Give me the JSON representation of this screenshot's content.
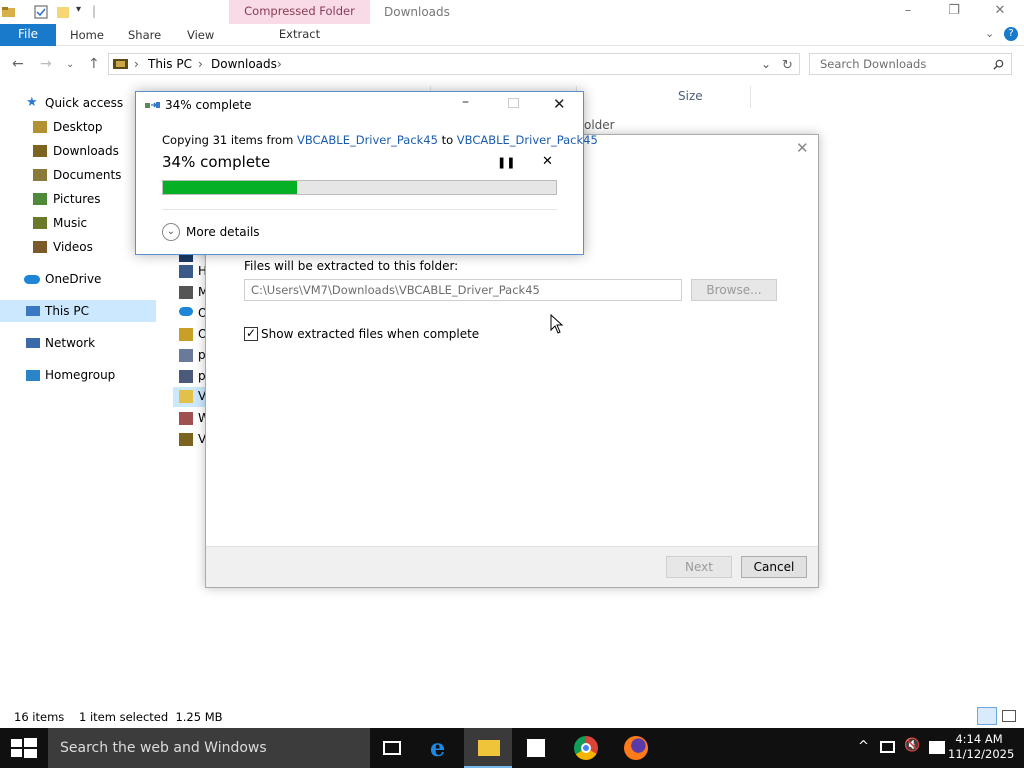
{
  "window": {
    "context_tab": "Compressed Folder Tools",
    "title": "Downloads",
    "tabs": [
      "File",
      "Home",
      "Share",
      "View"
    ],
    "extract_tab": "Extract"
  },
  "address": {
    "crumbs": [
      "This PC",
      "Downloads"
    ],
    "search_placeholder": "Search Downloads"
  },
  "navpane": {
    "items": [
      "Quick access",
      "Desktop",
      "Downloads",
      "Documents",
      "Pictures",
      "Music",
      "Videos",
      "OneDrive",
      "This PC",
      "Network",
      "Homegroup"
    ]
  },
  "filelist": {
    "size_header": "Size",
    "folder_fragment": "older",
    "row_letters": [
      "H",
      "M",
      "O",
      "O",
      "p",
      "p",
      "V",
      "W",
      "V"
    ]
  },
  "extract": {
    "folder_label": "Files will be extracted to this folder:",
    "path": "C:\\Users\\VM7\\Downloads\\VBCABLE_Driver_Pack45",
    "browse": "Browse...",
    "show_label": "Show extracted files when complete",
    "next": "Next",
    "cancel": "Cancel"
  },
  "progress": {
    "title": "34% complete",
    "copy_prefix": "Copying 31 items from",
    "source": "VBCABLE_Driver_Pack45",
    "to_word": "to",
    "dest": "VBCABLE_Driver_Pack45",
    "status": "34% complete",
    "value": 0.34,
    "more_details": "More details"
  },
  "statusbar": {
    "items": "16 items",
    "selected": "1 item selected  1.25 MB"
  },
  "taskbar": {
    "search_text": "Search the web and Windows",
    "time": "4:14 AM",
    "date": "11/12/2025"
  },
  "colors": {
    "accent": "#1979ca",
    "progress_fill": "#06b025",
    "link": "#1a5cb0"
  }
}
